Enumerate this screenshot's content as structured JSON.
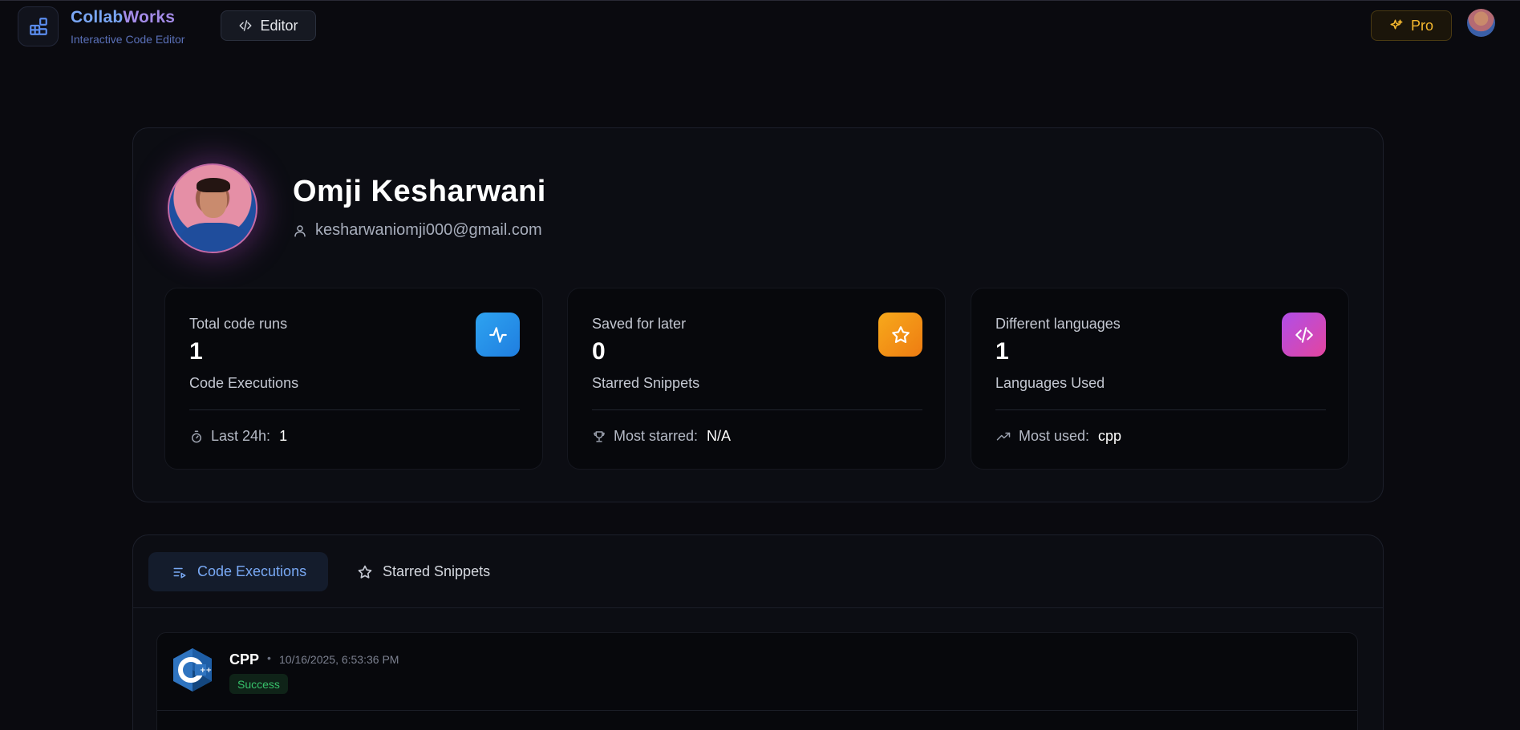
{
  "header": {
    "brand_title_main": "Collab",
    "brand_title_tail": "Works",
    "brand_subtitle": "Interactive Code Editor",
    "editor_label": "Editor",
    "pro_label": "Pro"
  },
  "profile": {
    "name": "Omji Kesharwani",
    "email": "kesharwaniomji000@gmail.com"
  },
  "stats": [
    {
      "label": "Total code runs",
      "value": "1",
      "description": "Code Executions",
      "footer_label": "Last 24h:",
      "footer_value": "1",
      "icon": "activity-icon",
      "accent": "#2ea3f0"
    },
    {
      "label": "Saved for later",
      "value": "0",
      "description": "Starred Snippets",
      "footer_label": "Most starred:",
      "footer_value": "N/A",
      "icon": "star-icon",
      "accent": "#f7a91b"
    },
    {
      "label": "Different languages",
      "value": "1",
      "description": "Languages Used",
      "footer_label": "Most used:",
      "footer_value": "cpp",
      "icon": "code-icon",
      "accent": "#b04ee8"
    }
  ],
  "tabs": [
    {
      "label": "Code Executions",
      "icon": "list-play-icon",
      "active": true
    },
    {
      "label": "Starred Snippets",
      "icon": "star-outline-icon",
      "active": false
    }
  ],
  "executions": [
    {
      "language": "CPP",
      "separator": "•",
      "timestamp": "10/16/2025, 6:53:36 PM",
      "status": "Success",
      "status_color": "#37c26b"
    }
  ]
}
